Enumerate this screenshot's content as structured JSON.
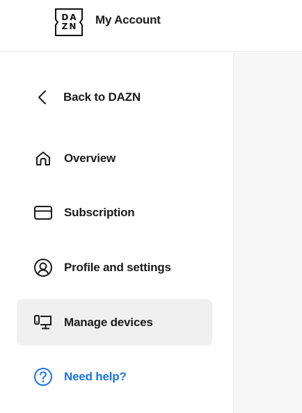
{
  "header": {
    "logo_top": "DA",
    "logo_bottom": "ZN",
    "title": "My Account"
  },
  "sidebar": {
    "back_label": "Back to DAZN",
    "items": [
      {
        "label": "Overview",
        "icon": "home-icon",
        "active": false
      },
      {
        "label": "Subscription",
        "icon": "credit-card-icon",
        "active": false
      },
      {
        "label": "Profile and settings",
        "icon": "user-circle-icon",
        "active": false
      },
      {
        "label": "Manage devices",
        "icon": "devices-icon",
        "active": true
      }
    ],
    "help_label": "Need help?"
  },
  "colors": {
    "accent": "#1a73e8",
    "active_background": "#f0f0f0",
    "main_background": "#f7f7f7",
    "text": "#1a1a1a"
  }
}
